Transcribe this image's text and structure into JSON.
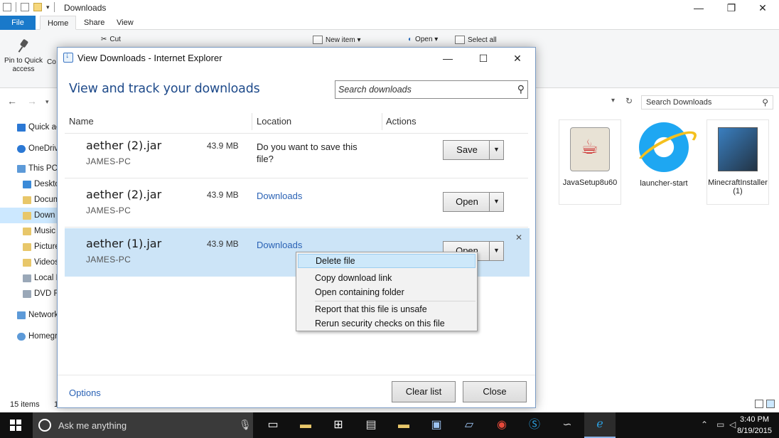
{
  "explorer": {
    "title": "Downloads",
    "tabs": [
      "File",
      "Home",
      "Share",
      "View"
    ],
    "ribbon": {
      "pin_label_1": "Pin to Quick",
      "pin_label_2": "access",
      "copy_label": "Co",
      "cut_label": "Cut",
      "new_item_label": "New item ▾",
      "open_label": "Open ▾",
      "select_all_label": "Select all"
    },
    "search_placeholder": "Search Downloads",
    "nav_items": [
      {
        "label": "Quick ac",
        "icon": "star-icon"
      },
      {
        "label": "OneDriv",
        "icon": "cloud-icon"
      },
      {
        "label": "This PC",
        "icon": "computer-icon"
      },
      {
        "label": "Deskto",
        "icon": "folder-icon"
      },
      {
        "label": "Docum",
        "icon": "folder-icon"
      },
      {
        "label": "Down",
        "icon": "download-folder-icon"
      },
      {
        "label": "Music",
        "icon": "music-icon"
      },
      {
        "label": "Picture",
        "icon": "pictures-icon"
      },
      {
        "label": "Videos",
        "icon": "videos-icon"
      },
      {
        "label": "Local D",
        "icon": "drive-icon"
      },
      {
        "label": "DVD R",
        "icon": "dvd-icon"
      },
      {
        "label": "Network",
        "icon": "network-icon"
      },
      {
        "label": "Homegr",
        "icon": "homegroup-icon"
      }
    ],
    "files": [
      {
        "name": "JavaSetup8u60",
        "icon": "java-icon"
      },
      {
        "name": "launcher-start",
        "icon": "ie-icon"
      },
      {
        "name": "MinecraftInstaller (1)",
        "icon": "installer-icon"
      }
    ],
    "status_items": "15 items",
    "status_extra": "1"
  },
  "dialog": {
    "title": "View Downloads - Internet Explorer",
    "heading": "View and track your downloads",
    "search_placeholder": "Search downloads",
    "columns": {
      "name": "Name",
      "location": "Location",
      "actions": "Actions"
    },
    "downloads": [
      {
        "name": "aether (2).jar",
        "host": "JAMES-PC",
        "size": "43.9 MB",
        "location": "Do you want to save this file?",
        "action": "Save"
      },
      {
        "name": "aether (2).jar",
        "host": "JAMES-PC",
        "size": "43.9 MB",
        "location": "Downloads",
        "action": "Open"
      },
      {
        "name": "aether (1).jar",
        "host": "JAMES-PC",
        "size": "43.9 MB",
        "location": "Downloads",
        "action": "Open"
      }
    ],
    "options_label": "Options",
    "clear_list_label": "Clear list",
    "close_label": "Close"
  },
  "context_menu": {
    "items": [
      "Delete file",
      "Copy download link",
      "Open containing folder",
      "Report that this file is unsafe",
      "Rerun security checks on this file"
    ]
  },
  "taskbar": {
    "search_text": "Ask me anything",
    "time": "3:40 PM",
    "date": "8/19/2015"
  }
}
